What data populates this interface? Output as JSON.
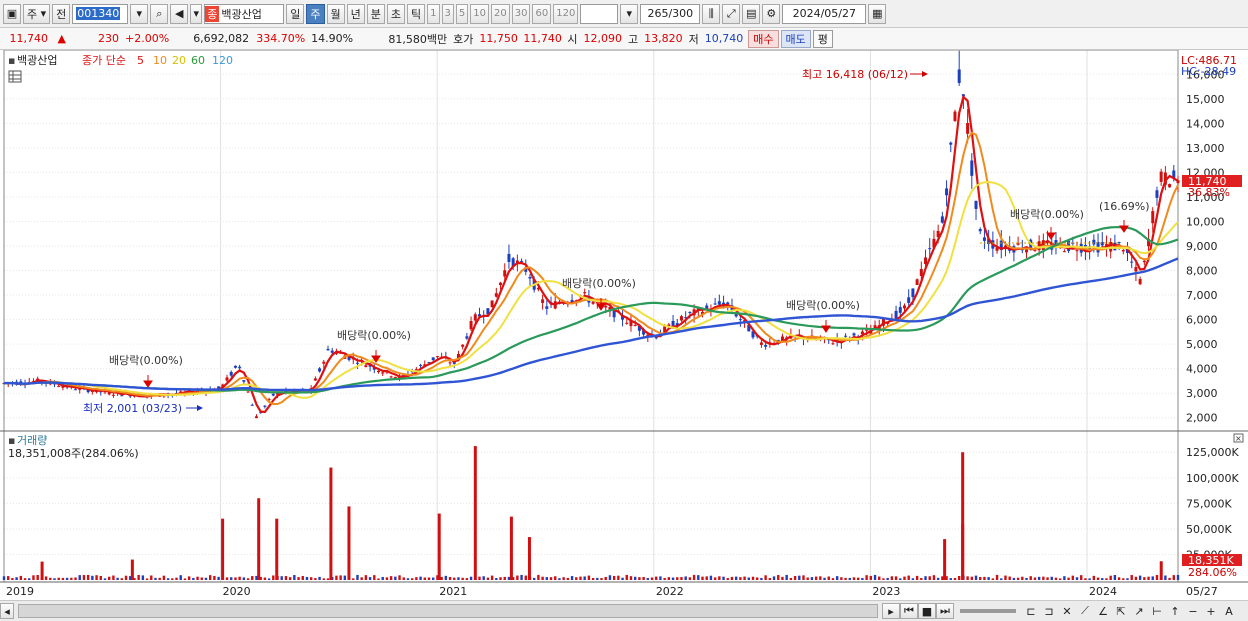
{
  "toolbar": {
    "market": "주",
    "prev": "전",
    "code": "001340",
    "name_badge": "종",
    "name": "백광산업",
    "periods": [
      "일",
      "주",
      "월",
      "년",
      "분",
      "초",
      "틱"
    ],
    "intervals": [
      "1",
      "3",
      "5",
      "10",
      "20",
      "30",
      "60",
      "120"
    ],
    "count": "265",
    "count_max": "/300",
    "date": "2024/05/27"
  },
  "quote": {
    "price": "11,740",
    "arrow": "▲",
    "change": "230",
    "change_pct": "+2.00%",
    "volume": "6,692,082",
    "volume_pct": "334.70%",
    "turnover": "14.90%",
    "amount": "81,580백만",
    "hoga_label": "호가",
    "ask": "11,750",
    "bid": "11,740",
    "open_label": "시",
    "open": "12,090",
    "high_label": "고",
    "high": "13,820",
    "low_label": "저",
    "low": "10,740",
    "buy": "매수",
    "sell": "매도",
    "avg": "평"
  },
  "legend": {
    "name": "백광산업",
    "desc": "종가 단순",
    "ma": [
      {
        "label": "5",
        "color": "#dd1111"
      },
      {
        "label": "10",
        "color": "#f08a1c"
      },
      {
        "label": "20",
        "color": "#e8d000"
      },
      {
        "label": "60",
        "color": "#2a9a3a"
      },
      {
        "label": "120",
        "color": "#3a9ad8"
      }
    ]
  },
  "right_info": {
    "lc": "LC:486.71",
    "hc": "HC:-28.49",
    "price_tag": "11,740",
    "pct_tag": "36.83%"
  },
  "annotations": {
    "high": "최고 16,418 (06/12)",
    "low": "최저 2,001 (03/23)",
    "div1": "배당락(0.00%)",
    "div2": "배당락(0.00%)",
    "div3": "배당락(0.00%)",
    "div4": "배당락(0.00%)",
    "div5": "배당락(0.00%)",
    "pct": "(16.69%)"
  },
  "volume_panel": {
    "title": "거래량",
    "value": "18,351,008주(284.06%)",
    "tag": "18,351K",
    "tag_pct": "284.06%"
  },
  "bottom": {
    "end_date": "05/27"
  },
  "chart_data": {
    "type": "candlestick",
    "x_labels": [
      "2019",
      "2020",
      "2021",
      "2022",
      "2023",
      "2024"
    ],
    "y_ticks": [
      "2,000",
      "3,000",
      "4,000",
      "5,000",
      "6,000",
      "7,000",
      "8,000",
      "9,000",
      "10,000",
      "11,000",
      "12,000",
      "13,000",
      "14,000",
      "15,000",
      "16,000"
    ],
    "ylim": [
      1500,
      16500
    ],
    "volume_ticks": [
      "25,000K",
      "50,000K",
      "75,000K",
      "100,000K",
      "125,000K"
    ],
    "volume_ylim": [
      0,
      135000
    ],
    "series": [
      {
        "name": "5",
        "color": "#dd1111"
      },
      {
        "name": "10",
        "color": "#f08a1c"
      },
      {
        "name": "20",
        "color": "#f0e040"
      },
      {
        "name": "60",
        "color": "#2a9a5a"
      },
      {
        "name": "120",
        "color": "#2f55d4"
      }
    ],
    "price_path": [
      [
        "2019-01",
        3400
      ],
      [
        "2019-03",
        3500
      ],
      [
        "2019-05",
        3200
      ],
      [
        "2019-07",
        3000
      ],
      [
        "2019-09",
        2900
      ],
      [
        "2019-11",
        3000
      ],
      [
        "2020-01",
        3200
      ],
      [
        "2020-02",
        4200
      ],
      [
        "2020-03",
        2001
      ],
      [
        "2020-04",
        3000
      ],
      [
        "2020-06",
        3100
      ],
      [
        "2020-07",
        4800
      ],
      [
        "2020-09",
        4200
      ],
      [
        "2020-11",
        3600
      ],
      [
        "2021-01",
        4500
      ],
      [
        "2021-02",
        4200
      ],
      [
        "2021-03",
        6000
      ],
      [
        "2021-04",
        6500
      ],
      [
        "2021-05",
        8500
      ],
      [
        "2021-06",
        8000
      ],
      [
        "2021-07",
        6500
      ],
      [
        "2021-09",
        7000
      ],
      [
        "2021-11",
        6200
      ],
      [
        "2022-01",
        5300
      ],
      [
        "2022-03",
        6200
      ],
      [
        "2022-05",
        6700
      ],
      [
        "2022-07",
        5000
      ],
      [
        "2022-09",
        5300
      ],
      [
        "2022-11",
        5100
      ],
      [
        "2023-01",
        5500
      ],
      [
        "2023-03",
        6500
      ],
      [
        "2023-05",
        10000
      ],
      [
        "2023-06",
        16418
      ],
      [
        "2023-07",
        9500
      ],
      [
        "2023-08",
        9000
      ],
      [
        "2024-03",
        9000
      ],
      [
        "2024-04",
        7500
      ],
      [
        "2024-05",
        11740
      ]
    ],
    "volume_bars": [
      [
        "2019-03",
        18000
      ],
      [
        "2019-08",
        20000
      ],
      [
        "2020-01",
        60000
      ],
      [
        "2020-03",
        80000
      ],
      [
        "2020-04",
        60000
      ],
      [
        "2020-07",
        110000
      ],
      [
        "2020-08",
        72000
      ],
      [
        "2021-01",
        65000
      ],
      [
        "2021-03",
        131000
      ],
      [
        "2021-05",
        62000
      ],
      [
        "2021-06",
        42000
      ],
      [
        "2023-05",
        40000
      ],
      [
        "2023-06",
        55000
      ],
      [
        "2023-06",
        125000
      ],
      [
        "2024-05",
        18351
      ]
    ]
  }
}
